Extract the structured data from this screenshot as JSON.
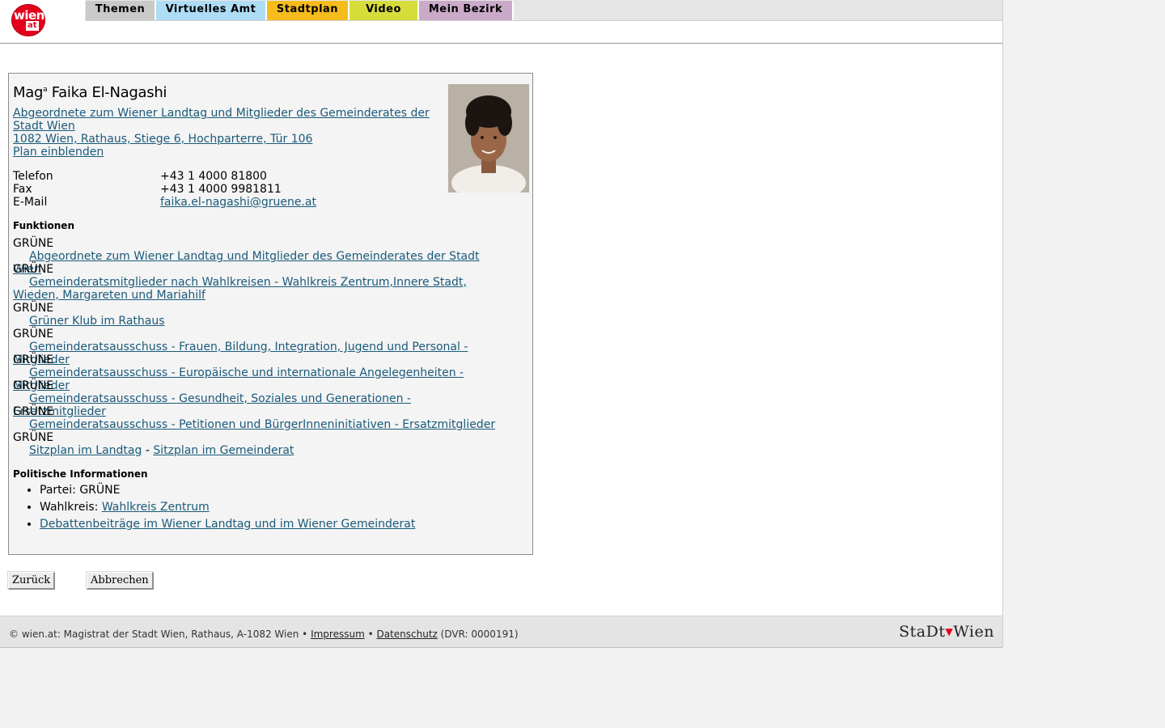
{
  "header": {
    "logo": {
      "main": "wien",
      "sub": "at"
    },
    "tabs": [
      {
        "label": "Themen",
        "color": "#c9c9c9"
      },
      {
        "label": "Virtuelles Amt",
        "color": "#aedcf5"
      },
      {
        "label": "Stadtplan",
        "color": "#f6bc1e"
      },
      {
        "label": "Video",
        "color": "#d6dc3a"
      },
      {
        "label": "Mein Bezirk",
        "color": "#cbaac9"
      }
    ]
  },
  "person": {
    "title_prefix": "Mag",
    "title_sup": "a",
    "name": "Faika El-Nagashi",
    "role_link_1": "Abgeordnete zum Wiener Landtag und Mitglieder des Gemeinderates der",
    "role_link_2": "Stadt Wien ",
    "address": "1082 Wien, Rathaus, Stiege 6, Hochparterre, Tür 106",
    "plan": "Plan einblenden",
    "contacts": [
      {
        "label": "Telefon",
        "value": "+43 1 4000 81800"
      },
      {
        "label": "Fax",
        "value": "+43 1 4000 9981811"
      },
      {
        "label": "E-Mail",
        "value": "faika.el-nagashi@gruene.at"
      }
    ]
  },
  "functions": {
    "heading": "Funktionen",
    "items": [
      {
        "party": "GRÜNE",
        "text": "Abgeordnete zum Wiener Landtag und Mitglieder des Gemeinderates der Stadt Wien"
      },
      {
        "party": "GRÜNE",
        "text": "Gemeinderatsmitglieder nach Wahlkreisen - Wahlkreis Zentrum,Innere Stadt, Wieden, Margareten und Mariahilf"
      },
      {
        "party": "GRÜNE",
        "text": "Grüner Klub im Rathaus"
      },
      {
        "party": "GRÜNE",
        "text": "Gemeinderatsausschuss - Frauen, Bildung, Integration, Jugend und Personal - Mitglieder"
      },
      {
        "party": "GRÜNE",
        "text": "Gemeinderatsausschuss - Europäische und internationale Angelegenheiten - Mitglieder"
      },
      {
        "party": "GRÜNE",
        "text": "Gemeinderatsausschuss - Gesundheit, Soziales und Generationen - Ersatzmitglieder"
      },
      {
        "party": "GRÜNE",
        "text": "Gemeinderatsausschuss - Petitionen und BürgerInneninitiativen - Ersatzmitglieder"
      }
    ],
    "last_party": "GRÜNE",
    "sitz_landtag": "Sitzplan im Landtag",
    "separator": " - ",
    "sitz_gemeinderat": "Sitzplan im Gemeinderat"
  },
  "political": {
    "heading": "Politische Informationen",
    "party_label": "Partei: ",
    "party_value": "GRÜNE",
    "district_label": "Wahlkreis: ",
    "district_value": "Wahlkreis Zentrum",
    "debates": "Debattenbeiträge im Wiener Landtag und im Wiener Gemeinderat"
  },
  "buttons": {
    "back": "Zurück",
    "cancel": "Abbrechen"
  },
  "footer": {
    "prefix": "© wien.at: Magistrat der Stadt Wien, Rathaus, A-1082 Wien • ",
    "impressum": "Impressum",
    "sep": " • ",
    "datenschutz": "Datenschutz",
    "suffix": " (DVR: 0000191)",
    "brand_left": "StaDt",
    "brand_right": "Wien"
  }
}
